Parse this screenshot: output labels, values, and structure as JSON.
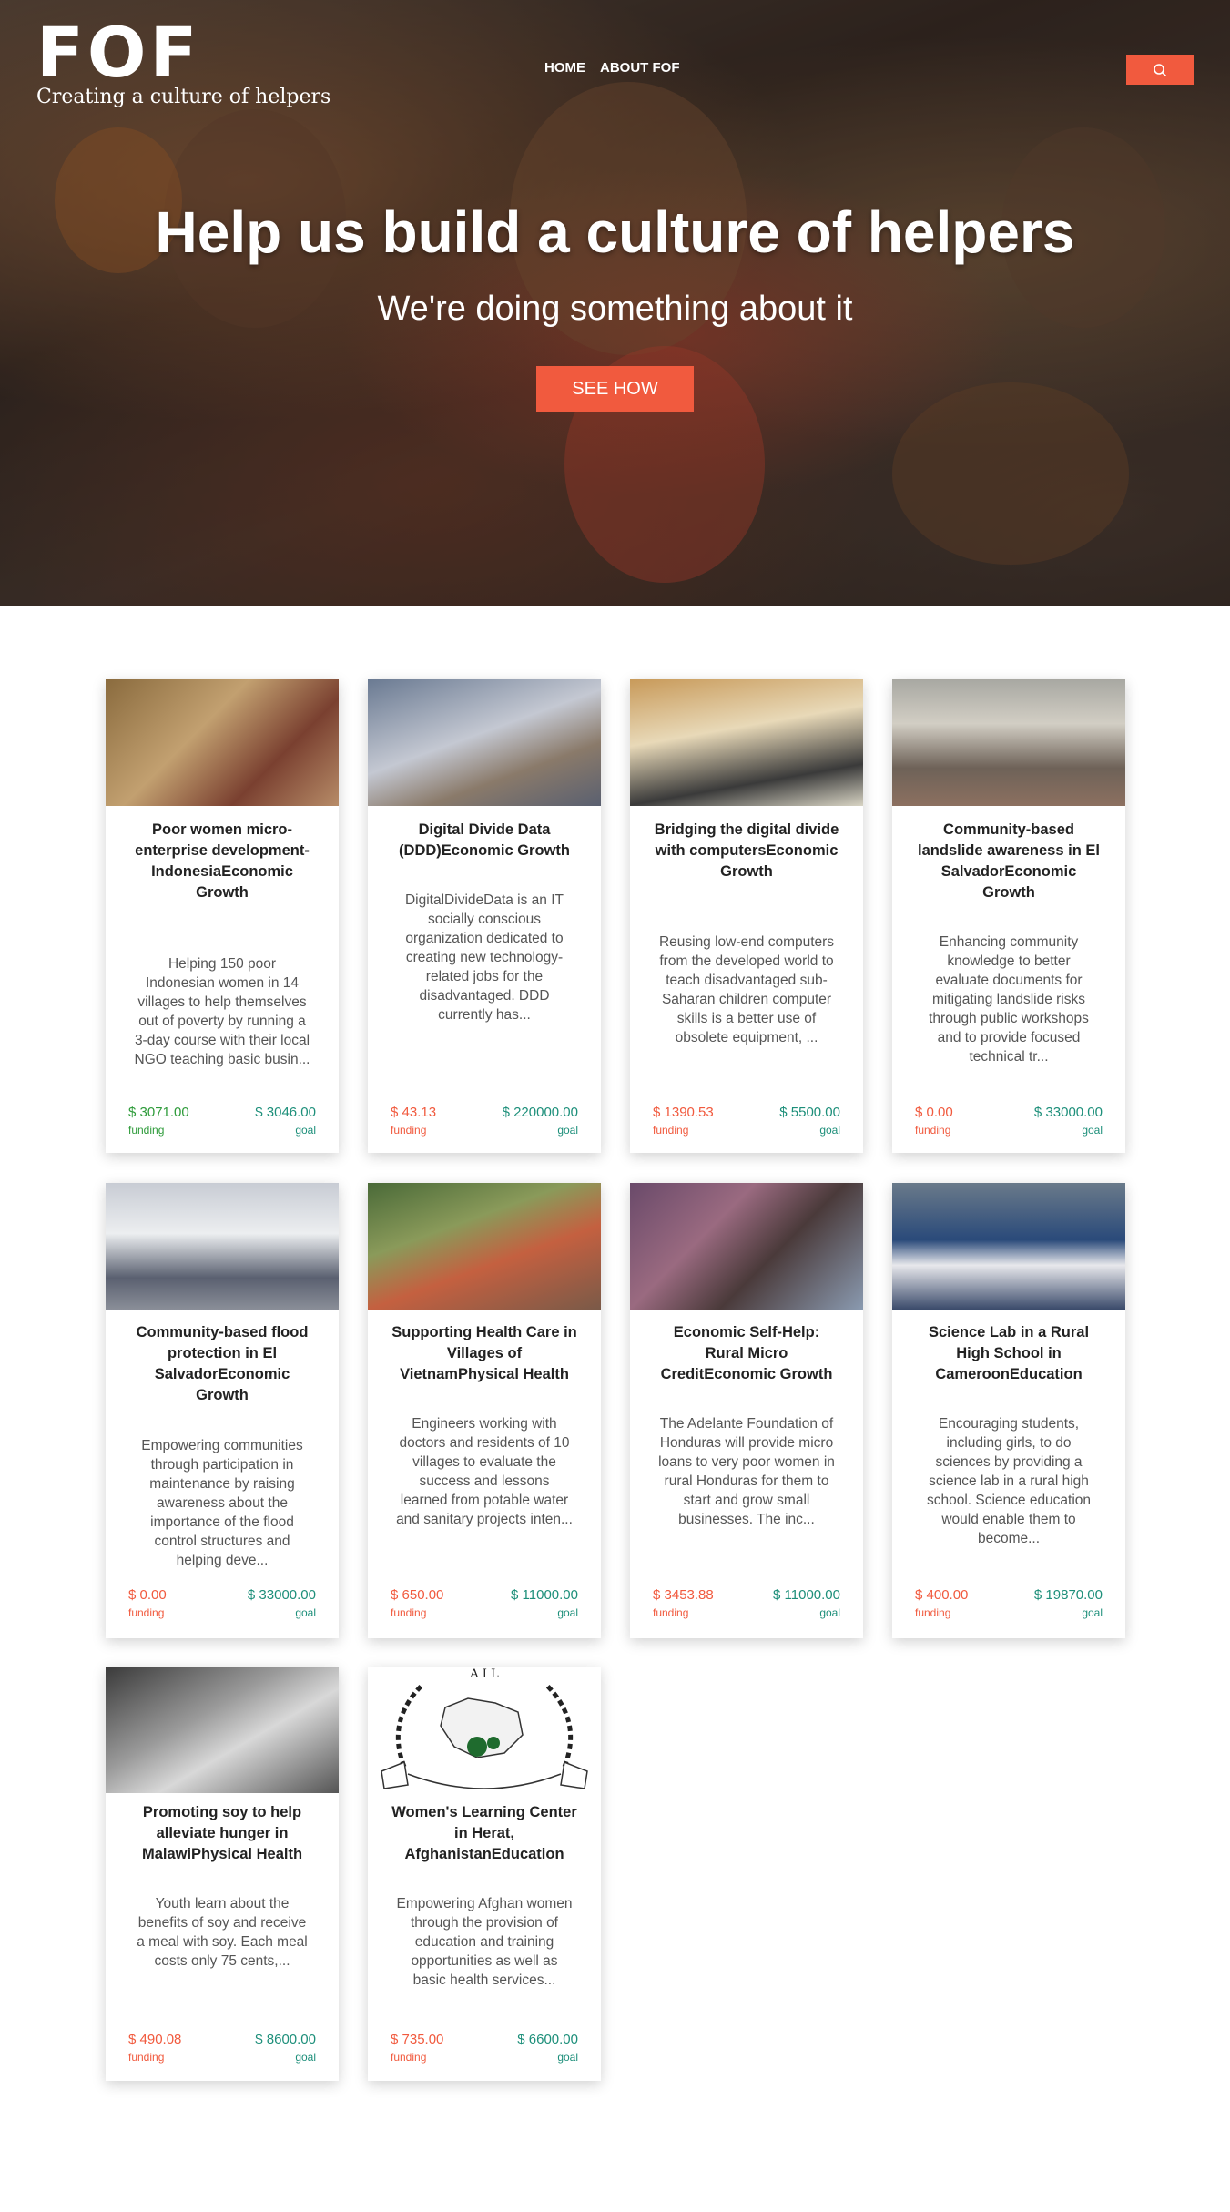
{
  "header": {
    "logo_text": "FOF",
    "tagline": "Creating a culture of  helpers",
    "nav": [
      "HOME",
      "ABOUT FOF"
    ],
    "search_icon": "search-icon"
  },
  "hero": {
    "title": "Help us build a culture of helpers",
    "subtitle": "We're doing something about it",
    "cta": "SEE HOW"
  },
  "colors": {
    "accent": "#f15a3e",
    "funding_green": "#2e9b3a",
    "goal_teal": "#1d8f7a",
    "funding_red": "#f15a3e"
  },
  "projects": [
    {
      "title": "Poor women micro-enterprise development-IndonesiaEconomic Growth",
      "desc": "Helping 150 poor Indonesian women in 14 villages to help themselves out of poverty by running a 3-day course with their local NGO teaching basic busin...",
      "funding": "$ 3071.00",
      "funding_label": "funding",
      "goal": "$ 3046.00",
      "goal_label": "goal",
      "funded": true
    },
    {
      "title": "Digital Divide Data (DDD)Economic Growth",
      "desc": "DigitalDivideData is an IT socially conscious organization dedicated to creating new technology-related jobs for the disadvantaged. DDD currently has...",
      "funding": "$ 43.13",
      "funding_label": "funding",
      "goal": "$ 220000.00",
      "goal_label": "goal",
      "funded": false
    },
    {
      "title": "Bridging the digital divide with computersEconomic Growth",
      "desc": "Reusing low-end computers from the developed world to teach disadvantaged sub-Saharan children computer skills is a better use of obsolete equipment, ...",
      "funding": "$ 1390.53",
      "funding_label": "funding",
      "goal": "$ 5500.00",
      "goal_label": "goal",
      "funded": false
    },
    {
      "title": "Community-based landslide awareness in El SalvadorEconomic Growth",
      "desc": "Enhancing community knowledge to better evaluate documents for mitigating landslide risks through public workshops and to provide focused technical tr...",
      "funding": "$ 0.00",
      "funding_label": "funding",
      "goal": "$ 33000.00",
      "goal_label": "goal",
      "funded": false
    },
    {
      "title": "Community-based flood protection in El SalvadorEconomic Growth",
      "desc": "Empowering communities through participation in maintenance by raising awareness about the importance of the flood control structures and helping deve...",
      "funding": "$ 0.00",
      "funding_label": "funding",
      "goal": "$ 33000.00",
      "goal_label": "goal",
      "funded": false
    },
    {
      "title": "Supporting Health Care in Villages of VietnamPhysical Health",
      "desc": "Engineers working with doctors and residents of 10 villages to evaluate the success and lessons learned from potable water and sanitary projects inten...",
      "funding": "$ 650.00",
      "funding_label": "funding",
      "goal": "$ 11000.00",
      "goal_label": "goal",
      "funded": false
    },
    {
      "title": "Economic Self-Help: Rural Micro CreditEconomic Growth",
      "desc": "The Adelante Foundation of Honduras will provide micro loans to very poor women in rural Honduras for them to start and grow small businesses. The inc...",
      "funding": "$ 3453.88",
      "funding_label": "funding",
      "goal": "$ 11000.00",
      "goal_label": "goal",
      "funded": false
    },
    {
      "title": "Science Lab in a Rural High School in CameroonEducation",
      "desc": "Encouraging students, including girls, to do sciences by providing a science lab in a rural high school. Science education would enable them to become...",
      "funding": "$ 400.00",
      "funding_label": "funding",
      "goal": "$ 19870.00",
      "goal_label": "goal",
      "funded": false
    },
    {
      "title": "Promoting soy to help alleviate hunger in MalawiPhysical Health",
      "desc": "Youth learn about the benefits of soy and receive a meal with soy. Each meal costs only 75 cents,...",
      "funding": "$ 490.08",
      "funding_label": "funding",
      "goal": "$ 8600.00",
      "goal_label": "goal",
      "funded": false
    },
    {
      "title": "Women's Learning Center in Herat, AfghanistanEducation",
      "desc": "Empowering Afghan women through the provision of education and training opportunities as well as basic health services...",
      "funding": "$ 735.00",
      "funding_label": "funding",
      "goal": "$ 6600.00",
      "goal_label": "goal",
      "funded": false,
      "logo_text": "A I L"
    }
  ]
}
